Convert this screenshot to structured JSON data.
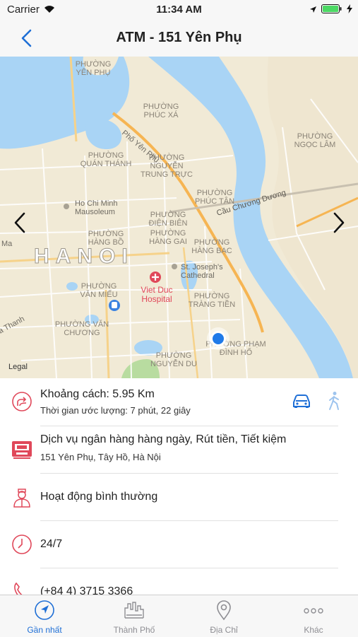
{
  "status_bar": {
    "carrier": "Carrier",
    "time": "11:34 AM"
  },
  "nav": {
    "title": "ATM - 151 Yên Phụ"
  },
  "map": {
    "legal": "Legal",
    "labels": [
      {
        "text": "PHƯỜNG",
        "kind": "ward"
      },
      {
        "text": "YÊN PHỤ",
        "kind": "ward"
      },
      {
        "text": "PHƯỜNG",
        "kind": "ward"
      },
      {
        "text": "PHÚC XÁ",
        "kind": "ward"
      },
      {
        "text": "Phố Yên Phụ",
        "kind": "road"
      },
      {
        "text": "PHƯỜNG",
        "kind": "ward"
      },
      {
        "text": "QUÁN THÁNH",
        "kind": "ward"
      },
      {
        "text": "PHƯỜNG",
        "kind": "ward"
      },
      {
        "text": "NGUYỄN",
        "kind": "ward"
      },
      {
        "text": "TRUNG TRỰC",
        "kind": "ward"
      },
      {
        "text": "PHƯỜNG",
        "kind": "ward"
      },
      {
        "text": "NGỌC LÂM",
        "kind": "ward"
      },
      {
        "text": "PHƯỜNG",
        "kind": "ward"
      },
      {
        "text": "PHÚC TÂN",
        "kind": "ward"
      },
      {
        "text": "Cầu Chương Dương",
        "kind": "road"
      },
      {
        "text": "Ho Chi Minh",
        "kind": "poi"
      },
      {
        "text": "Mausoleum",
        "kind": "poi"
      },
      {
        "text": "PHƯỜNG",
        "kind": "ward"
      },
      {
        "text": "HÀNG BỒ",
        "kind": "ward"
      },
      {
        "text": "PHƯỜNG",
        "kind": "ward"
      },
      {
        "text": "ĐIỆN BIÊN",
        "kind": "ward"
      },
      {
        "text": "PHƯỜNG",
        "kind": "ward"
      },
      {
        "text": "HÀNG GAI",
        "kind": "ward"
      },
      {
        "text": "PHƯỜNG",
        "kind": "ward"
      },
      {
        "text": "HÀNG BẠC",
        "kind": "ward"
      },
      {
        "text": "HANOI",
        "kind": "city"
      },
      {
        "text": "St. Joseph's",
        "kind": "poi"
      },
      {
        "text": "Cathedral",
        "kind": "poi"
      },
      {
        "text": "PHƯỜNG",
        "kind": "ward"
      },
      {
        "text": "VĂN MIẾU",
        "kind": "ward"
      },
      {
        "text": "Viet Duc",
        "kind": "hospital"
      },
      {
        "text": "Hospital",
        "kind": "hospital"
      },
      {
        "text": "PHƯỜNG",
        "kind": "ward"
      },
      {
        "text": "TRÀNG TIỀN",
        "kind": "ward"
      },
      {
        "text": "PHƯỜNG VĂN",
        "kind": "ward"
      },
      {
        "text": "CHƯƠNG",
        "kind": "ward"
      },
      {
        "text": "PHƯỜNG PHẠM",
        "kind": "ward"
      },
      {
        "text": "ĐÌNH HỔ",
        "kind": "ward"
      },
      {
        "text": "PHƯỜNG",
        "kind": "ward"
      },
      {
        "text": "NGUYỄN DU",
        "kind": "ward"
      },
      {
        "text": "Ma",
        "kind": "road"
      },
      {
        "text": "a Thanh",
        "kind": "road"
      }
    ]
  },
  "info": {
    "distance": "Khoảng cách: 5.95 Km",
    "eta": "Thời gian ước lượng: 7 phút, 22 giây",
    "services": "Dịch vụ ngân hàng hàng ngày, Rút tiền, Tiết kiệm",
    "address": "151 Yên Phụ, Tây Hồ, Hà Nội",
    "status": "Hoạt động bình thường",
    "hours": "24/7",
    "phone": "(+84 4) 3715 3366"
  },
  "tabs": [
    {
      "label": "Gần nhất",
      "icon": "navigation-arrow-icon",
      "active": true
    },
    {
      "label": "Thành Phố",
      "icon": "city-skyline-icon",
      "active": false
    },
    {
      "label": "Địa Chỉ",
      "icon": "location-pin-icon",
      "active": false
    },
    {
      "label": "Khác",
      "icon": "more-dots-icon",
      "active": false
    }
  ],
  "colors": {
    "accent": "#1f6fd6",
    "icon_red": "#e0485a",
    "water": "#a9d4f5",
    "land": "#f1ead6",
    "major_road": "#f6b553"
  }
}
